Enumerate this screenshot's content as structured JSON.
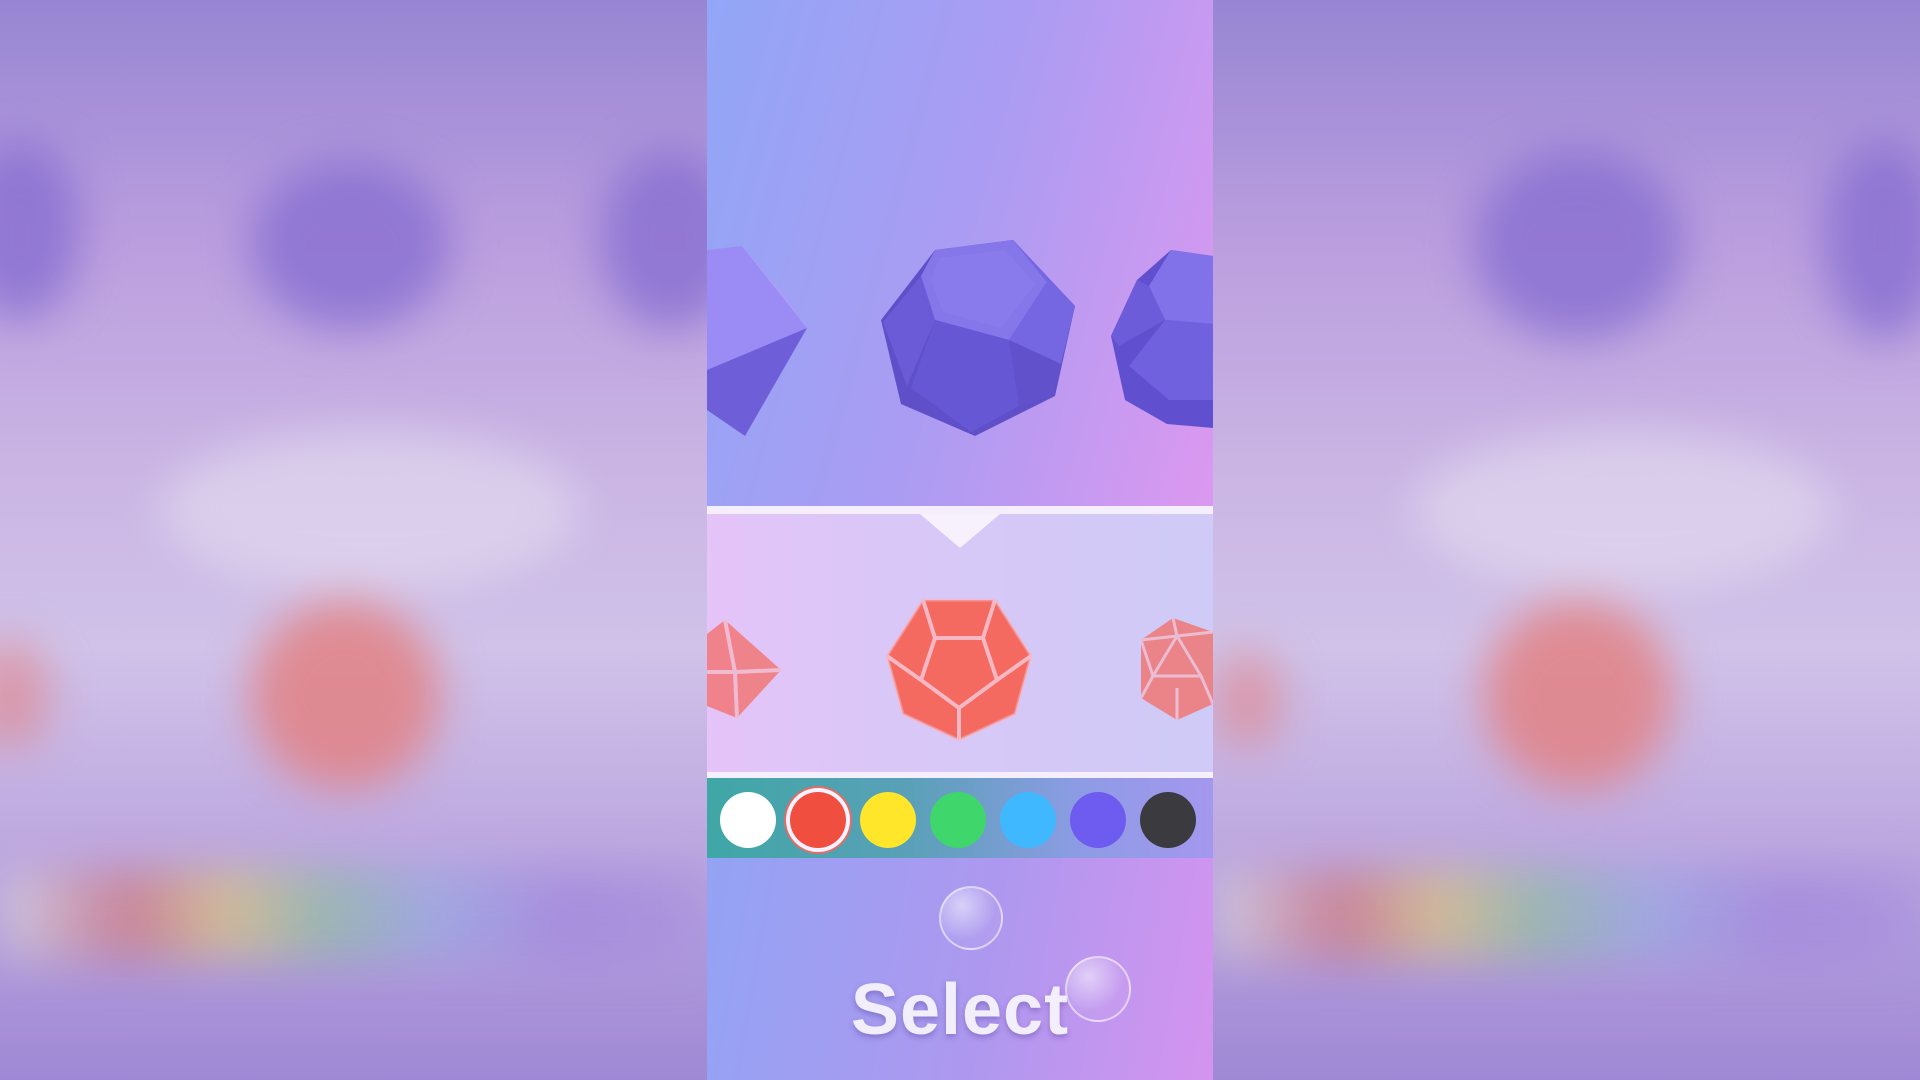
{
  "select_button": {
    "label": "Select"
  },
  "shape_carousel": {
    "items": [
      {
        "name": "octahedron",
        "color": "#7a6ae6"
      },
      {
        "name": "dodecahedron",
        "color": "#7565e4",
        "selected": true
      },
      {
        "name": "icosahedron",
        "color": "#7464e2"
      }
    ]
  },
  "style_carousel": {
    "items": [
      {
        "name": "octahedron-style"
      },
      {
        "name": "dodecahedron-style",
        "selected": true
      },
      {
        "name": "icosahedron-style"
      }
    ],
    "fill_color": "#f46a60",
    "line_color": "#f6b8c4"
  },
  "color_palette": {
    "selected_index": 1,
    "colors": [
      {
        "name": "white",
        "hex": "#ffffff"
      },
      {
        "name": "red",
        "hex": "#f04e3e"
      },
      {
        "name": "yellow",
        "hex": "#ffe62a"
      },
      {
        "name": "green",
        "hex": "#3fd66b"
      },
      {
        "name": "light-blue",
        "hex": "#3fb8ff"
      },
      {
        "name": "purple",
        "hex": "#6e5bf0"
      },
      {
        "name": "dark-gray",
        "hex": "#3b3b3f"
      }
    ]
  }
}
